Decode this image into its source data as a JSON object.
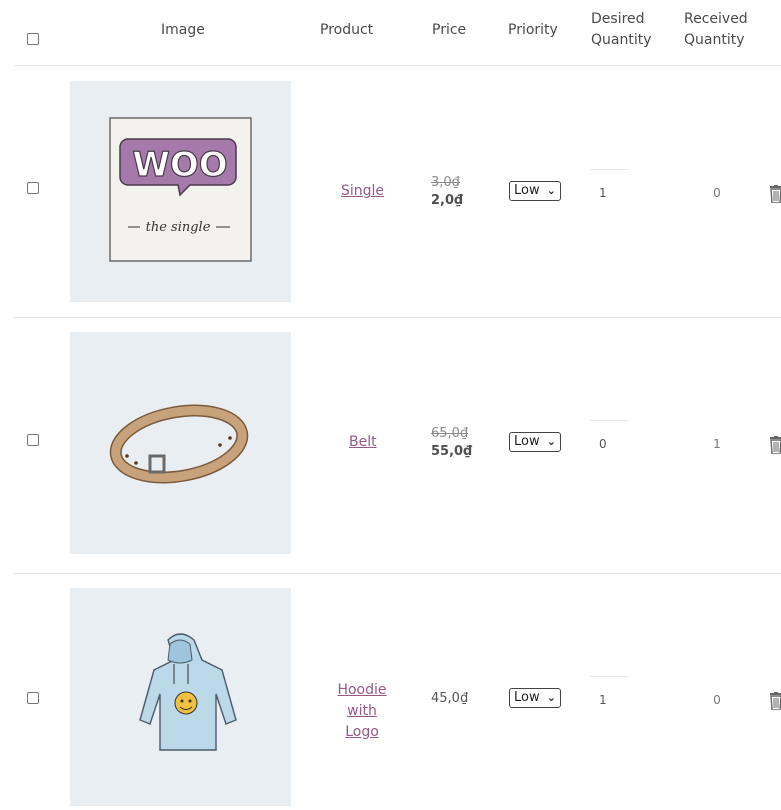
{
  "header": {
    "image": "Image",
    "product": "Product",
    "price": "Price",
    "priority": "Priority",
    "desired_1": "Desired",
    "desired_2": "Quantity",
    "received_1": "Received",
    "received_2": "Quantity"
  },
  "rows": [
    {
      "product": "Single",
      "image_text_1": "WOO",
      "image_text_2": "the single",
      "price_old": "3,0₫",
      "price_new": "2,0₫",
      "priority": "Low",
      "desired": "1",
      "received": "0"
    },
    {
      "product": "Belt",
      "price_old": "65,0₫",
      "price_new": "55,0₫",
      "priority": "Low",
      "desired": "0",
      "received": "1"
    },
    {
      "product_1": "Hoodie with",
      "product_2": "Logo",
      "price": "45,0₫",
      "priority": "Low",
      "desired": "1",
      "received": "0"
    }
  ],
  "icons": [
    "checkbox-icon",
    "trash-icon",
    "chevron-down-icon"
  ],
  "colors": {
    "link": "#96588a",
    "thumb_bg": "#e9eef2"
  }
}
